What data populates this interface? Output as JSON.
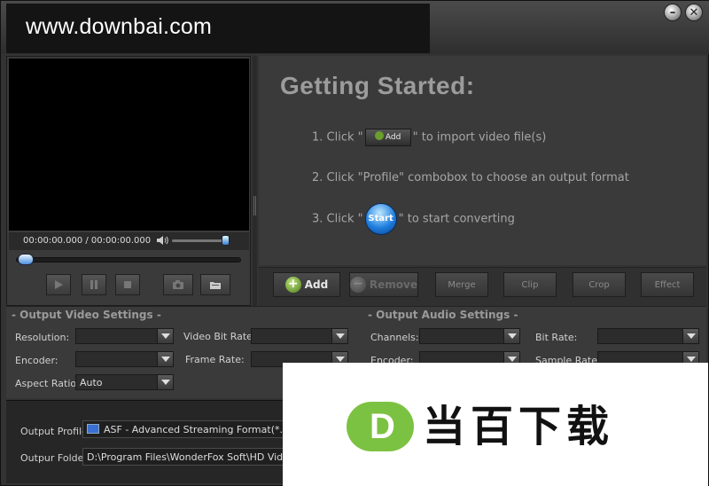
{
  "watermark": {
    "top_text": "www.downbai.com",
    "logo_letter": "D",
    "logo_text": "当百下载"
  },
  "window": {
    "minimize": "–",
    "close": "✕"
  },
  "player": {
    "time": "00:00:00.000 / 00:00:00.000",
    "icons": [
      "speaker-icon",
      "play-icon",
      "pause-icon",
      "stop-icon",
      "camera-icon",
      "folder-icon"
    ]
  },
  "getting_started": {
    "title": "Getting Started:",
    "step1_pre": "1. Click \"",
    "step1_btn": "Add",
    "step1_post": "\" to import video file(s)",
    "step2": "2. Click \"Profile\" combobox to choose an output format",
    "step3_pre": "3. Click \"",
    "step3_btn": "Start",
    "step3_post": "\" to start converting"
  },
  "toolbar": {
    "add": "Add",
    "remove": "Remove",
    "merge": "Merge",
    "clip": "Clip",
    "crop": "Crop",
    "effect": "Effect"
  },
  "video_settings": {
    "title": "- Output Video Settings -",
    "resolution": "Resolution:",
    "video_bit_rate": "Video Bit Rate:",
    "encoder": "Encoder:",
    "frame_rate": "Frame Rate:",
    "aspect_ratio": "Aspect Ratio:",
    "aspect_value": "Auto"
  },
  "audio_settings": {
    "title": "- Output Audio Settings -",
    "channels": "Channels:",
    "bit_rate": "Bit Rate:",
    "encoder": "Encoder:",
    "sample_rate": "Sample Rate:"
  },
  "output": {
    "profile_label": "Output Profile:",
    "profile_value": "ASF - Advanced Streaming Format(*.asf)",
    "folder_label": "Outpur Folder:",
    "folder_value": "D:\\Program Files\\WonderFox Soft\\HD Video Con"
  }
}
